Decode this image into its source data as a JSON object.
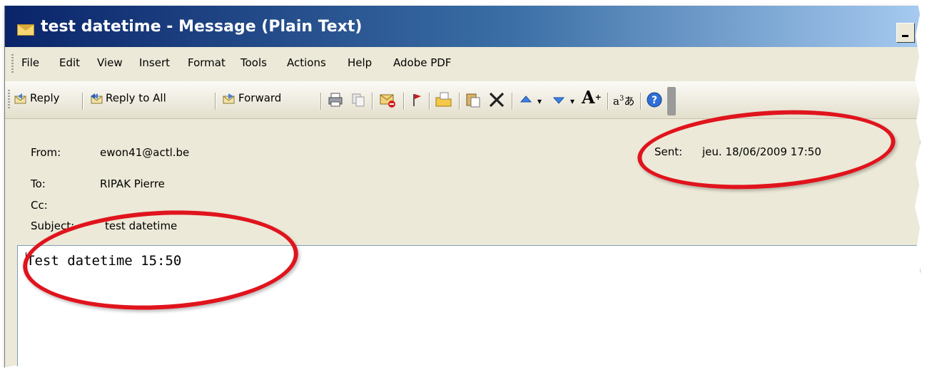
{
  "window": {
    "title": "test datetime - Message (Plain Text)"
  },
  "menu": {
    "items": [
      "File",
      "Edit",
      "View",
      "Insert",
      "Format",
      "Tools",
      "Actions",
      "Help",
      "Adobe PDF"
    ]
  },
  "toolbar": {
    "reply": "Reply",
    "reply_all": "Reply to All",
    "forward": "Forward",
    "icons": [
      "print-icon",
      "copy-icon",
      "delete-mail-icon",
      "flag-icon",
      "move-to-folder-icon",
      "paste-icon",
      "delete-icon",
      "previous-item-icon",
      "next-item-icon",
      "font-size-icon",
      "encoding-icon",
      "help-icon"
    ]
  },
  "header": {
    "from_label": "From:",
    "from_value": "ewon41@actl.be",
    "to_label": "To:",
    "to_value": "RIPAK Pierre",
    "cc_label": "Cc:",
    "subject_label": "Subject:",
    "subject_value": "test datetime",
    "sent_label": "Sent:",
    "sent_value": "jeu. 18/06/2009 17:50"
  },
  "body": {
    "text": "Test datetime 15:50"
  },
  "colors": {
    "title_bar": "#0a246a",
    "chrome": "#ece9d8",
    "annotation": "#e0141d"
  }
}
